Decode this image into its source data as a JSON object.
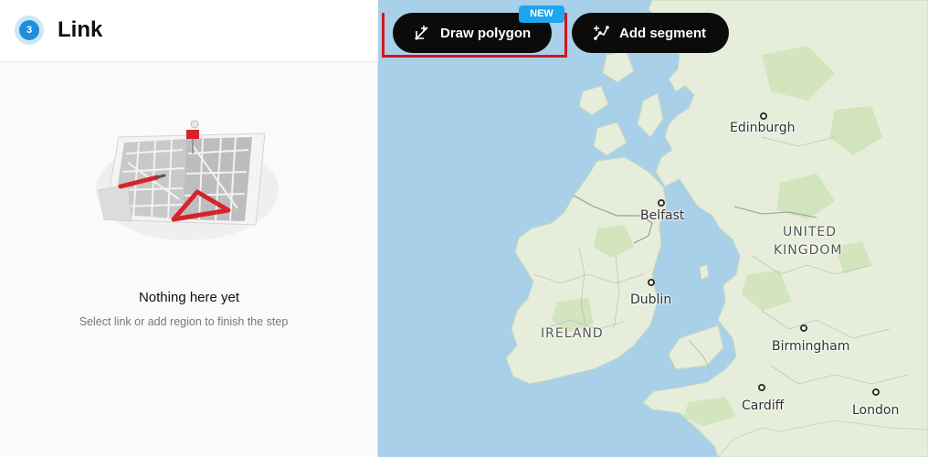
{
  "panel": {
    "step_number": "3",
    "title": "Link",
    "empty_state": {
      "title": "Nothing here yet",
      "subtitle": "Select link or add region to finish the step"
    }
  },
  "toolbar": {
    "draw_polygon_label": "Draw polygon",
    "new_badge": "NEW",
    "add_segment_label": "Add segment"
  },
  "map": {
    "labels": {
      "edinburgh": "Edinburgh",
      "belfast": "Belfast",
      "united": "UNITED",
      "kingdom": "KINGDOM",
      "dublin": "Dublin",
      "ireland": "IRELAND",
      "birmingham": "Birmingham",
      "cardiff": "Cardiff",
      "london": "London"
    }
  },
  "colors": {
    "accent": "#1f8fdc",
    "button_bg": "#0b0b0b",
    "badge_new": "#1fa4ef",
    "highlight": "#d4161b",
    "sea": "#a9d0e9",
    "land": "#e6eedb"
  }
}
